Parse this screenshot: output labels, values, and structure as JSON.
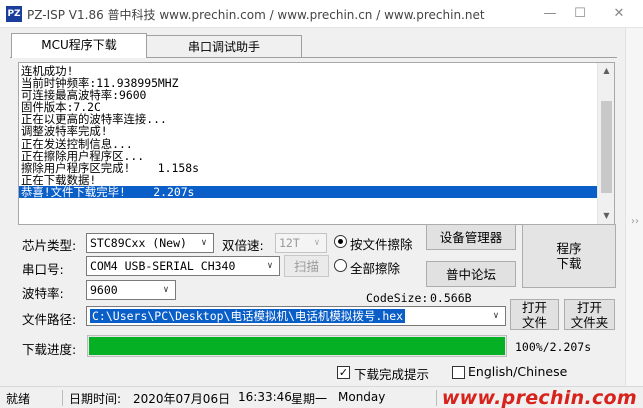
{
  "window": {
    "title": "PZ-ISP V1.86 普中科技 www.prechin.com / www.prechin.cn / www.prechin.net",
    "icon_text": "PZ",
    "minimize_icon": "minimize-icon",
    "maximize_icon": "maximize-icon",
    "close_icon": "close-icon"
  },
  "tabs": [
    {
      "label": "MCU程序下载",
      "active": true
    },
    {
      "label": "串口调试助手",
      "active": false
    }
  ],
  "log": {
    "lines": [
      "连机成功!",
      "当前时钟频率:11.938995MHZ",
      "可连接最高波特率:9600",
      "固件版本:7.2C",
      "正在以更高的波特率连接...",
      "调整波特率完成!",
      "正在发送控制信息...",
      "正在擦除用户程序区...",
      "擦除用户程序区完成!    1.158s",
      "正在下载数据!",
      "恭喜!文件下载完毕!    2.207s"
    ],
    "highlighted_index": 10
  },
  "form": {
    "chip_label": "芯片类型:",
    "chip_value": "STC89Cxx (New)",
    "speed_label": "双倍速:",
    "speed_value": "12T",
    "port_label": "串口号:",
    "port_value": "COM4  USB-SERIAL CH340",
    "scan_label": "扫描",
    "baud_label": "波特率:",
    "baud_value": "9600",
    "codesize_label": "CodeSize:",
    "codesize_value": "0.566B",
    "file_label": "文件路径:",
    "file_value": "C:\\Users\\PC\\Desktop\\电话模拟机\\电话机模拟拨号.hex",
    "progress_label": "下载进度:",
    "progress_percent": 100,
    "progress_text": "100%/2.207s"
  },
  "erase": {
    "by_file": "按文件擦除",
    "all": "全部擦除",
    "selected": "by_file"
  },
  "buttons": {
    "device_manager": "设备管理器",
    "forum": "普中论坛",
    "program_line1": "程序",
    "program_line2": "下载",
    "open_file_line1": "打开",
    "open_file_line2": "文件",
    "open_folder_line1": "打开",
    "open_folder_line2": "文件夹"
  },
  "checks": {
    "download_done_tip": "下载完成提示",
    "download_done_tip_checked": true,
    "language": "English/Chinese",
    "language_checked": false
  },
  "status": {
    "state": "就绪",
    "date_label": "日期时间:",
    "date": "2020年07月06日",
    "time": "16:33:46",
    "weekday": "星期一",
    "weekday_en": "Monday",
    "watermark": "www.prechin.com"
  },
  "colors": {
    "progress_fill": "#06b025",
    "highlight": "#0a5ec8",
    "watermark": "#d8221c"
  }
}
